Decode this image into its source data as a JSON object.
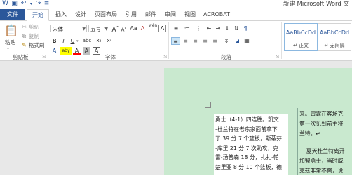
{
  "title_bar": {
    "doc_title": "新建 Microsoft Word 文"
  },
  "tabs": [
    {
      "label": "文件"
    },
    {
      "label": "开始"
    },
    {
      "label": "插入"
    },
    {
      "label": "设计"
    },
    {
      "label": "页面布局"
    },
    {
      "label": "引用"
    },
    {
      "label": "邮件"
    },
    {
      "label": "审阅"
    },
    {
      "label": "视图"
    },
    {
      "label": "ACROBAT"
    }
  ],
  "clipboard": {
    "paste_label": "粘贴",
    "cut_label": "剪切",
    "copy_label": "复制",
    "format_painter_label": "格式刷",
    "group_label": "剪贴板"
  },
  "font": {
    "font_name": "宋体",
    "font_size": "五号",
    "grow_label": "A",
    "shrink_label": "A",
    "aa_label": "Aa",
    "clear_label": "A",
    "wen_label": "wén",
    "bold": "B",
    "italic": "I",
    "underline": "U",
    "strike": "abc",
    "subscript": "x₂",
    "superscript": "x²",
    "effects": "A",
    "highlight": "aby",
    "color": "A",
    "char_shade": "A",
    "char_border": "A",
    "group_label": "字体"
  },
  "paragraph": {
    "group_label": "段落"
  },
  "styles": {
    "items": [
      {
        "sample": "AaBbCcDd",
        "name": "↵ 正文"
      },
      {
        "sample": "AaBbCcDd",
        "name": "↵ 无间隔"
      }
    ]
  },
  "document": {
    "col1_lines": [
      "勇士（4-1）四连胜。凯文",
      "-杜兰特在老东家面前拿下",
      "了 39 分 7 个篮板，斯蒂芬",
      "-库里 21 分 7 次助攻，克",
      "雷-汤普森 18 分，扎扎-帕",
      "楚里亚 8 分 10 个篮板，德"
    ],
    "col2_lines": [
      "来。雷霆在客场克",
      "第一次见到前主将",
      "兰特。↵",
      "",
      "    夏天杜兰特离开",
      "加盟勇士，当时威",
      "克兹非常不爽，说"
    ]
  }
}
